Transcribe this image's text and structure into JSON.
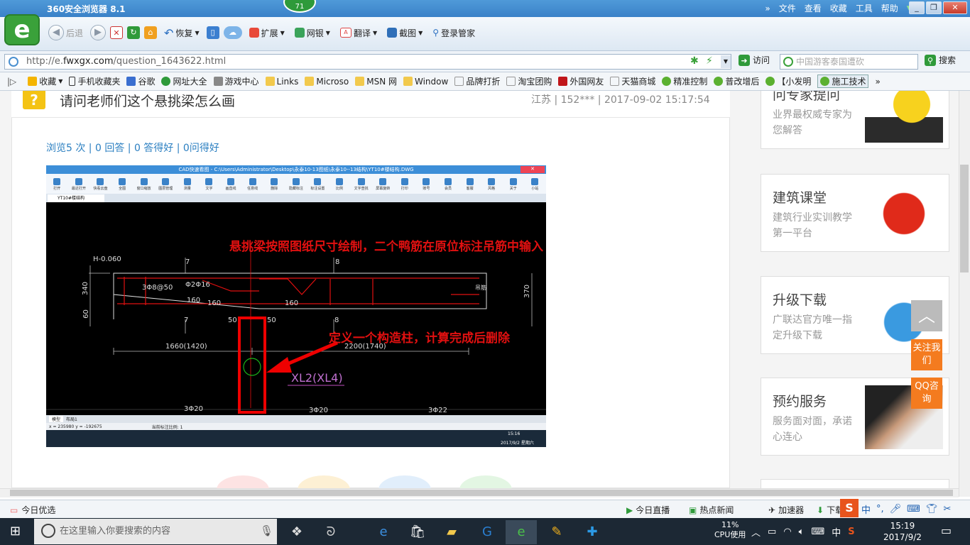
{
  "browser": {
    "title": "360安全浏览器 8.1",
    "badge": "71",
    "menu": [
      "文件",
      "查看",
      "收藏",
      "工具",
      "帮助"
    ],
    "nav": {
      "back": "后退",
      "restore": "恢复"
    },
    "tools": [
      "扩展",
      "网银",
      "翻译",
      "截图",
      "登录管家"
    ],
    "url_prefix": "http://e.",
    "url_domain": "fwxgx.com",
    "url_path": "/question_1643622.html",
    "visit": "访问",
    "search_placeholder": "中国游客泰国遭砍",
    "search_btn": "搜索"
  },
  "bookmarks": [
    "收藏",
    "手机收藏夹",
    "谷歌",
    "网址大全",
    "游戏中心",
    "Links",
    "Microso",
    "MSN 网",
    "Window",
    "品牌打折",
    "淘宝团购",
    "外国网友",
    "天猫商城",
    "精准控制",
    "普改增后",
    "【小发明",
    "施工技术"
  ],
  "question": {
    "title": "请问老师们这个悬挑梁怎么画",
    "meta": "江苏 | 152*** | 2017-09-02 15:17:54",
    "stats": "浏览5 次 | 0 回答 | 0 答得好 | 0问得好"
  },
  "cad": {
    "window_title": "CAD快速看图 - C:\\Users\\Administrator\\Desktop\\永泰10-13图纸\\永泰10--13结构\\YT10#楼结构.DWG",
    "tools": [
      "打开",
      "最近打开",
      "快看云盘",
      "全图",
      "窗口缩放",
      "图层管理",
      "测量",
      "文字",
      "画直线",
      "任意线",
      "删除",
      "隐藏标注",
      "标注设置",
      "比例",
      "文字查找",
      "屏幕旋转",
      "打印",
      "账号",
      "会员",
      "客服",
      "风格",
      "关于",
      "小站"
    ],
    "tab": "YT10#楼结构",
    "annotation1": "悬挑梁按照图纸尺寸绘制，二个鸭筋在原位标注吊筋中输入",
    "annotation2": "定义一个构造柱，计算完成后删除",
    "labels": {
      "h": "H-0.060",
      "n7a": "7",
      "n8a": "8",
      "n7b": "7",
      "n8b": "8",
      "s340": "340",
      "s60": "60",
      "s370": "370",
      "stir": "3Φ8@50",
      "bar": "Φ2Φ16",
      "d160a": "160",
      "d160b": "160",
      "d160c": "160",
      "d50a": "50",
      "d50b": "50",
      "len1": "1660(1420)",
      "len2": "2200(1740)",
      "xl": "XL2(XL4)",
      "b1": "3Φ20",
      "b2": "3Φ20",
      "b3": "3Φ22",
      "tag": "吊筋"
    },
    "bottom_tabs": [
      "模型",
      "布局1"
    ],
    "coords": "x = 235980  y = -192675",
    "scale": "当前标注比例: 1",
    "clock": "15:16",
    "date": "2017/9/2 星期六"
  },
  "sidebar": [
    {
      "title": "问专家提问",
      "sub": "业界最权威专家为您解答"
    },
    {
      "title": "建筑课堂",
      "sub": "建筑行业实训教学第一平台"
    },
    {
      "title": "升级下载",
      "sub": "广联达官方唯一指定升级下载"
    },
    {
      "title": "预约服务",
      "sub": "服务面对面，承诺心连心"
    }
  ],
  "float": {
    "follow": "关注我们",
    "qq": "QQ咨询"
  },
  "statusbar": {
    "left": "今日优选",
    "live": "今日直播",
    "news": "热点新闻",
    "accel": "加速器",
    "download": "下载",
    "ime": "中"
  },
  "taskbar": {
    "search": "在这里输入你要搜索的内容",
    "cpu_pct": "11%",
    "cpu_label": "CPU使用",
    "ime": "中",
    "time": "15:19",
    "date": "2017/9/2"
  }
}
